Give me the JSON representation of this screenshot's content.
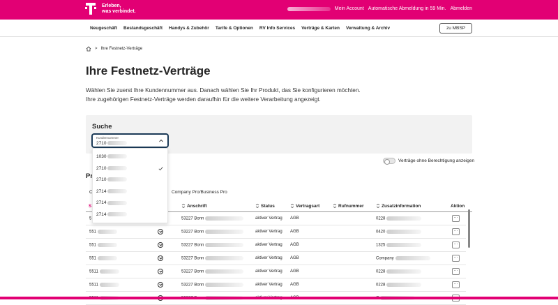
{
  "brand": {
    "slogan_line1": "Erleben,",
    "slogan_line2": "was verbindet.",
    "color": "#e20074"
  },
  "header": {
    "my_account": "Mein Account",
    "logout_timer": "Automatische Abmeldung in 59 Min.",
    "logout": "Abmelden"
  },
  "nav": {
    "items": [
      "Neugeschäft",
      "Bestandsgeschäft",
      "Handys & Zubehör",
      "Tarife & Optionen",
      "RV Info Services",
      "Verträge & Karten",
      "Verwaltung & Archiv"
    ],
    "mbsp_button": "zu MBSP"
  },
  "breadcrumb": {
    "separator": ">",
    "current": "Ihre Festnetz-Verträge"
  },
  "page": {
    "title": "Ihre Festnetz-Verträge",
    "intro_line1": "Wählen Sie zuerst Ihre Kundennummer aus. Danach wählen Sie Ihr Produkt, das Sie konfigurieren möchten.",
    "intro_line2": "Ihre zugehörigen Festnetz-Verträge werden daraufhin für die weitere Verarbeitung angezeigt."
  },
  "search": {
    "title": "Suche",
    "field_label": "Kundennummer",
    "field_value": "2710",
    "options": [
      {
        "value": "1030",
        "selected": false
      },
      {
        "value": "2710",
        "selected": true
      },
      {
        "value": "2710",
        "selected": false
      },
      {
        "value": "2714",
        "selected": false
      },
      {
        "value": "2714",
        "selected": false
      },
      {
        "value": "2714",
        "selected": false
      }
    ]
  },
  "toggle": {
    "label": "Verträge ohne Berechtigung anzeigen",
    "on": false
  },
  "products": {
    "heading": "Pr",
    "tabs": [
      "C",
      "k",
      "Company Pro/Business Pro"
    ]
  },
  "table": {
    "columns": [
      "S",
      "Anschrift",
      "Status",
      "Vertragsart",
      "Rufnummer",
      "Zusatzinformation",
      "Aktion"
    ],
    "rows": [
      {
        "id": "5",
        "address": "53227 Bonn",
        "status": "aktiver Vertrag",
        "type": "AGB",
        "extra": "0228"
      },
      {
        "id": "551",
        "address": "53227 Bonn",
        "status": "aktiver Vertrag",
        "type": "AGB",
        "extra": "0420"
      },
      {
        "id": "551",
        "address": "53227 Bonn",
        "status": "aktiver Vertrag",
        "type": "AGB",
        "extra": "1325"
      },
      {
        "id": "551",
        "address": "53227 Bonn",
        "status": "aktiver Vertrag",
        "type": "AGB",
        "extra": "Company"
      },
      {
        "id": "5511",
        "address": "53227 Bonn",
        "status": "aktiver Vertrag",
        "type": "AGB",
        "extra": "0228"
      },
      {
        "id": "5511",
        "address": "53227 Bonn",
        "status": "aktiver Vertrag",
        "type": "AGB",
        "extra": "0228"
      },
      {
        "id": "5511",
        "address": "53227 Bonn",
        "status": "aktiver Vertrag",
        "type": "AGB",
        "extra": "C"
      }
    ],
    "action_label": "···"
  }
}
